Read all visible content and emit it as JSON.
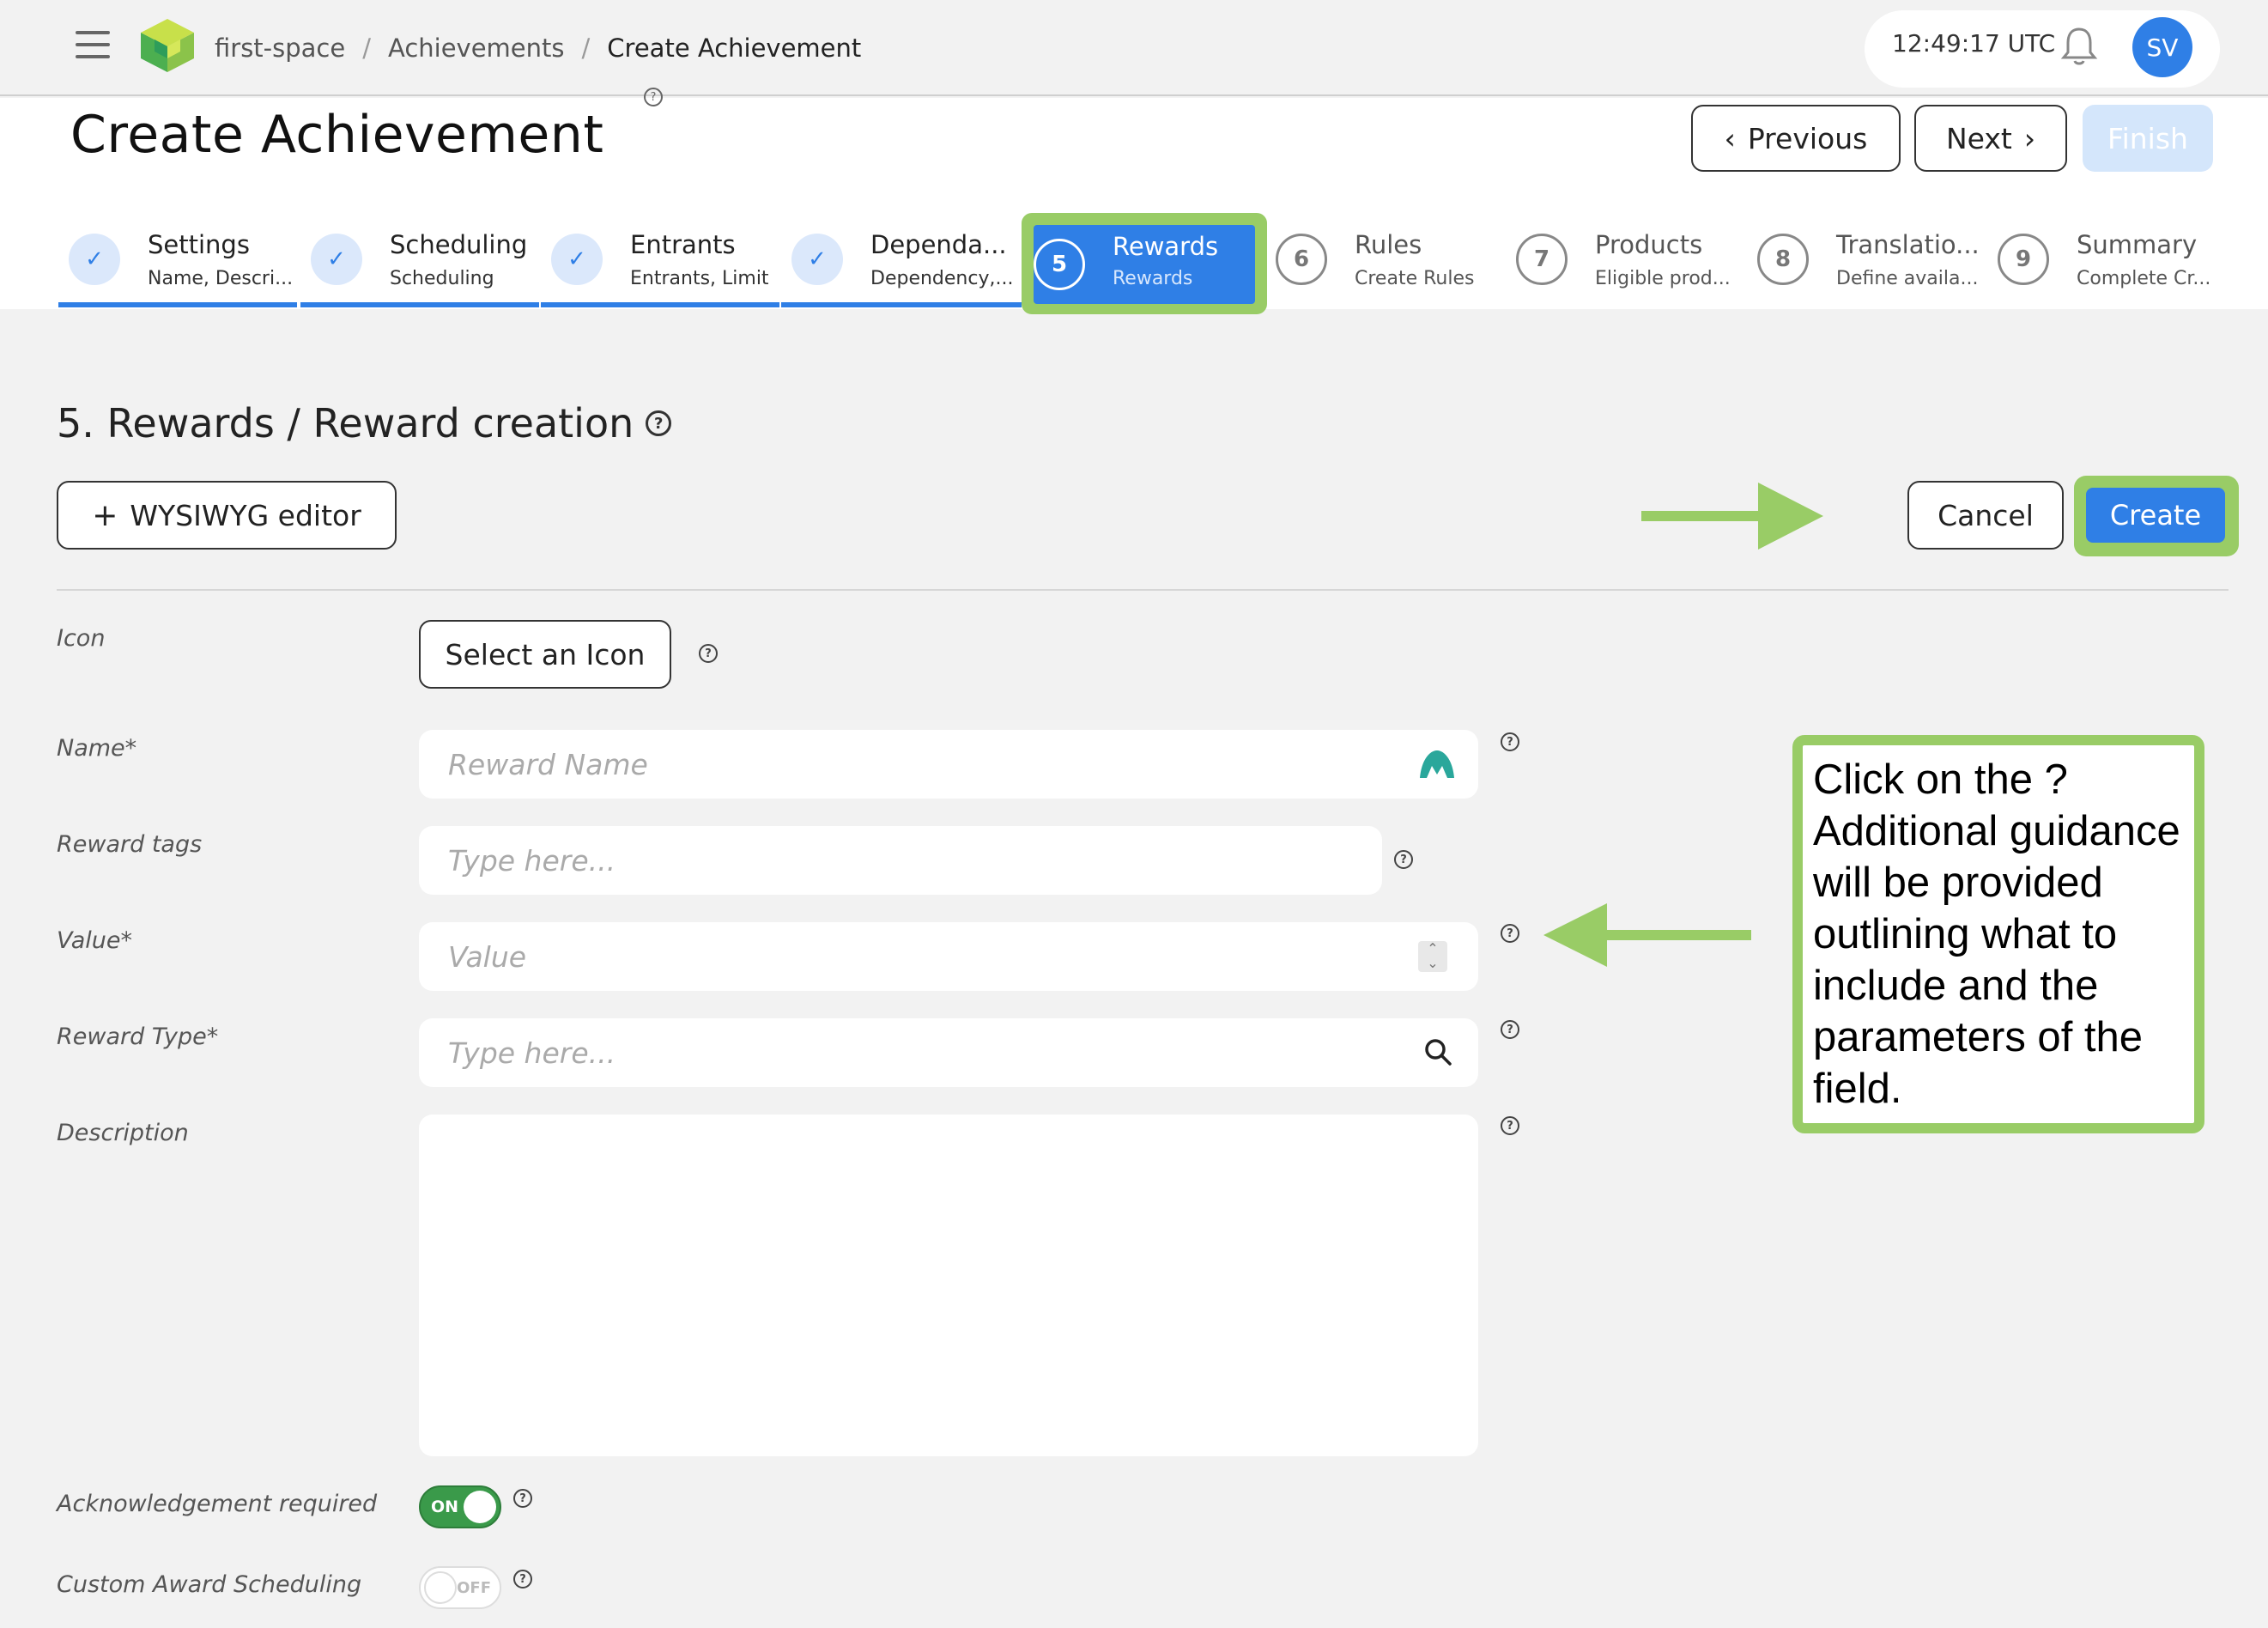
{
  "topbar": {
    "breadcrumbs": [
      "first-space",
      "Achievements",
      "Create Achievement"
    ],
    "clock": "12:49:17 UTC",
    "avatar_initials": "SV"
  },
  "header": {
    "title": "Create Achievement",
    "previous_label": "Previous",
    "next_label": "Next",
    "finish_label": "Finish"
  },
  "steps": [
    {
      "label": "Settings",
      "sub": "Name, Descri...",
      "state": "done"
    },
    {
      "label": "Scheduling",
      "sub": "Scheduling",
      "state": "done"
    },
    {
      "label": "Entrants",
      "sub": "Entrants, Limit",
      "state": "done"
    },
    {
      "label": "Dependa...",
      "sub": "Dependency,...",
      "state": "done"
    },
    {
      "number": "5",
      "label": "Rewards",
      "sub": "Rewards",
      "state": "active"
    },
    {
      "number": "6",
      "label": "Rules",
      "sub": "Create Rules",
      "state": "todo"
    },
    {
      "number": "7",
      "label": "Products",
      "sub": "Eligible prod...",
      "state": "todo"
    },
    {
      "number": "8",
      "label": "Translatio...",
      "sub": "Define availa...",
      "state": "todo"
    },
    {
      "number": "9",
      "label": "Summary",
      "sub": "Complete Cr...",
      "state": "todo"
    }
  ],
  "section": {
    "title": "5. Rewards / Reward creation",
    "wysiwyg_label": "WYSIWYG editor",
    "cancel_label": "Cancel",
    "create_label": "Create"
  },
  "form": {
    "icon_label": "Icon",
    "icon_button": "Select an Icon",
    "name_label": "Name*",
    "name_placeholder": "Reward Name",
    "tags_label": "Reward tags",
    "tags_placeholder": "Type here...",
    "value_label": "Value*",
    "value_placeholder": "Value",
    "type_label": "Reward Type*",
    "type_placeholder": "Type here...",
    "description_label": "Description",
    "ack_label": "Acknowledgement required",
    "ack_state": "ON",
    "custom_label": "Custom Award Scheduling",
    "custom_state": "OFF"
  },
  "annotation": {
    "text": "Click on the ? Additional guidance will be provided outlining what to include and the parameters of the field.",
    "color": "#99cc66"
  },
  "colors": {
    "accent": "#2f7fe6",
    "highlight": "#99cc66",
    "toggle_on": "#3a9a4a"
  }
}
